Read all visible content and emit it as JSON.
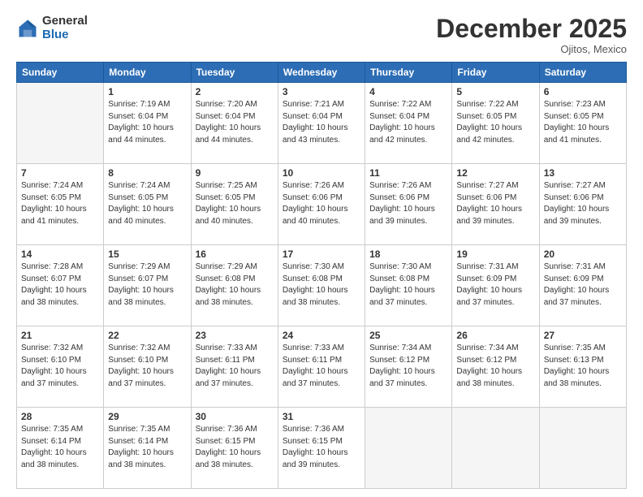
{
  "header": {
    "logo_general": "General",
    "logo_blue": "Blue",
    "month": "December 2025",
    "location": "Ojitos, Mexico"
  },
  "days_of_week": [
    "Sunday",
    "Monday",
    "Tuesday",
    "Wednesday",
    "Thursday",
    "Friday",
    "Saturday"
  ],
  "weeks": [
    [
      {
        "day": "",
        "empty": true
      },
      {
        "day": "1",
        "sunrise": "7:19 AM",
        "sunset": "6:04 PM",
        "daylight": "10 hours and 44 minutes."
      },
      {
        "day": "2",
        "sunrise": "7:20 AM",
        "sunset": "6:04 PM",
        "daylight": "10 hours and 44 minutes."
      },
      {
        "day": "3",
        "sunrise": "7:21 AM",
        "sunset": "6:04 PM",
        "daylight": "10 hours and 43 minutes."
      },
      {
        "day": "4",
        "sunrise": "7:22 AM",
        "sunset": "6:04 PM",
        "daylight": "10 hours and 42 minutes."
      },
      {
        "day": "5",
        "sunrise": "7:22 AM",
        "sunset": "6:05 PM",
        "daylight": "10 hours and 42 minutes."
      },
      {
        "day": "6",
        "sunrise": "7:23 AM",
        "sunset": "6:05 PM",
        "daylight": "10 hours and 41 minutes."
      }
    ],
    [
      {
        "day": "7",
        "sunrise": "7:24 AM",
        "sunset": "6:05 PM",
        "daylight": "10 hours and 41 minutes."
      },
      {
        "day": "8",
        "sunrise": "7:24 AM",
        "sunset": "6:05 PM",
        "daylight": "10 hours and 40 minutes."
      },
      {
        "day": "9",
        "sunrise": "7:25 AM",
        "sunset": "6:05 PM",
        "daylight": "10 hours and 40 minutes."
      },
      {
        "day": "10",
        "sunrise": "7:26 AM",
        "sunset": "6:06 PM",
        "daylight": "10 hours and 40 minutes."
      },
      {
        "day": "11",
        "sunrise": "7:26 AM",
        "sunset": "6:06 PM",
        "daylight": "10 hours and 39 minutes."
      },
      {
        "day": "12",
        "sunrise": "7:27 AM",
        "sunset": "6:06 PM",
        "daylight": "10 hours and 39 minutes."
      },
      {
        "day": "13",
        "sunrise": "7:27 AM",
        "sunset": "6:06 PM",
        "daylight": "10 hours and 39 minutes."
      }
    ],
    [
      {
        "day": "14",
        "sunrise": "7:28 AM",
        "sunset": "6:07 PM",
        "daylight": "10 hours and 38 minutes."
      },
      {
        "day": "15",
        "sunrise": "7:29 AM",
        "sunset": "6:07 PM",
        "daylight": "10 hours and 38 minutes."
      },
      {
        "day": "16",
        "sunrise": "7:29 AM",
        "sunset": "6:08 PM",
        "daylight": "10 hours and 38 minutes."
      },
      {
        "day": "17",
        "sunrise": "7:30 AM",
        "sunset": "6:08 PM",
        "daylight": "10 hours and 38 minutes."
      },
      {
        "day": "18",
        "sunrise": "7:30 AM",
        "sunset": "6:08 PM",
        "daylight": "10 hours and 37 minutes."
      },
      {
        "day": "19",
        "sunrise": "7:31 AM",
        "sunset": "6:09 PM",
        "daylight": "10 hours and 37 minutes."
      },
      {
        "day": "20",
        "sunrise": "7:31 AM",
        "sunset": "6:09 PM",
        "daylight": "10 hours and 37 minutes."
      }
    ],
    [
      {
        "day": "21",
        "sunrise": "7:32 AM",
        "sunset": "6:10 PM",
        "daylight": "10 hours and 37 minutes."
      },
      {
        "day": "22",
        "sunrise": "7:32 AM",
        "sunset": "6:10 PM",
        "daylight": "10 hours and 37 minutes."
      },
      {
        "day": "23",
        "sunrise": "7:33 AM",
        "sunset": "6:11 PM",
        "daylight": "10 hours and 37 minutes."
      },
      {
        "day": "24",
        "sunrise": "7:33 AM",
        "sunset": "6:11 PM",
        "daylight": "10 hours and 37 minutes."
      },
      {
        "day": "25",
        "sunrise": "7:34 AM",
        "sunset": "6:12 PM",
        "daylight": "10 hours and 37 minutes."
      },
      {
        "day": "26",
        "sunrise": "7:34 AM",
        "sunset": "6:12 PM",
        "daylight": "10 hours and 38 minutes."
      },
      {
        "day": "27",
        "sunrise": "7:35 AM",
        "sunset": "6:13 PM",
        "daylight": "10 hours and 38 minutes."
      }
    ],
    [
      {
        "day": "28",
        "sunrise": "7:35 AM",
        "sunset": "6:14 PM",
        "daylight": "10 hours and 38 minutes."
      },
      {
        "day": "29",
        "sunrise": "7:35 AM",
        "sunset": "6:14 PM",
        "daylight": "10 hours and 38 minutes."
      },
      {
        "day": "30",
        "sunrise": "7:36 AM",
        "sunset": "6:15 PM",
        "daylight": "10 hours and 38 minutes."
      },
      {
        "day": "31",
        "sunrise": "7:36 AM",
        "sunset": "6:15 PM",
        "daylight": "10 hours and 39 minutes."
      },
      {
        "day": "",
        "empty": true
      },
      {
        "day": "",
        "empty": true
      },
      {
        "day": "",
        "empty": true
      }
    ]
  ],
  "labels": {
    "sunrise": "Sunrise:",
    "sunset": "Sunset:",
    "daylight": "Daylight:"
  }
}
